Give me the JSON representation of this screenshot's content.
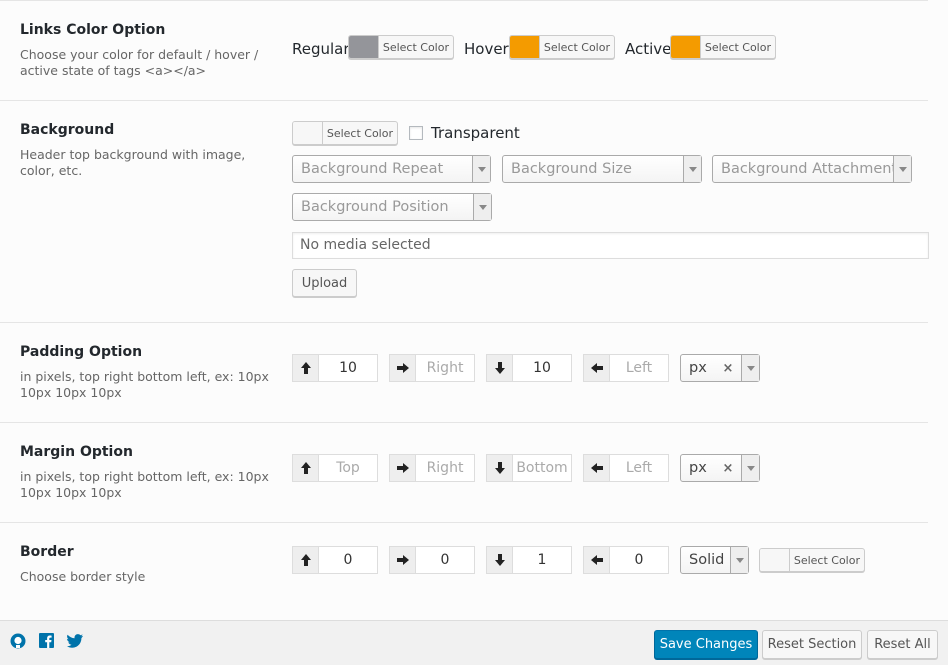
{
  "links_color": {
    "title": "Links Color Option",
    "description": "Choose your color for default / hover / active state of tags <a></a>",
    "regular_label": "Regular",
    "hover_label": "Hover",
    "active_label": "Active",
    "select_color": "Select Color",
    "regular_color": "#94959a",
    "hover_color": "#f49b00",
    "active_color": "#f49b00"
  },
  "background": {
    "title": "Background",
    "description": "Header top background with image, color, etc.",
    "select_color": "Select Color",
    "transparent_label": "Transparent",
    "repeat_placeholder": "Background Repeat",
    "size_placeholder": "Background Size",
    "attachment_placeholder": "Background Attachment",
    "position_placeholder": "Background Position",
    "media_placeholder": "No media selected",
    "upload_label": "Upload"
  },
  "padding": {
    "title": "Padding Option",
    "description": "in pixels, top right bottom left, ex: 10px 10px 10px 10px",
    "top": "10",
    "right": "Right",
    "bottom": "10",
    "left": "Left",
    "unit": "px",
    "unit_clear": "×"
  },
  "margin": {
    "title": "Margin Option",
    "description": "in pixels, top right bottom left, ex: 10px 10px 10px 10px",
    "top": "Top",
    "right": "Right",
    "bottom": "Bottom",
    "left": "Left",
    "unit": "px",
    "unit_clear": "×"
  },
  "border": {
    "title": "Border",
    "description": "Choose border style",
    "top": "0",
    "right": "0",
    "bottom": "1",
    "left": "0",
    "style": "Solid",
    "select_color": "Select Color"
  },
  "footer": {
    "save": "Save Changes",
    "reset_section": "Reset Section",
    "reset_all": "Reset All"
  },
  "colors": {
    "primary": "#0085ba",
    "icon_blue": "#0073aa"
  }
}
